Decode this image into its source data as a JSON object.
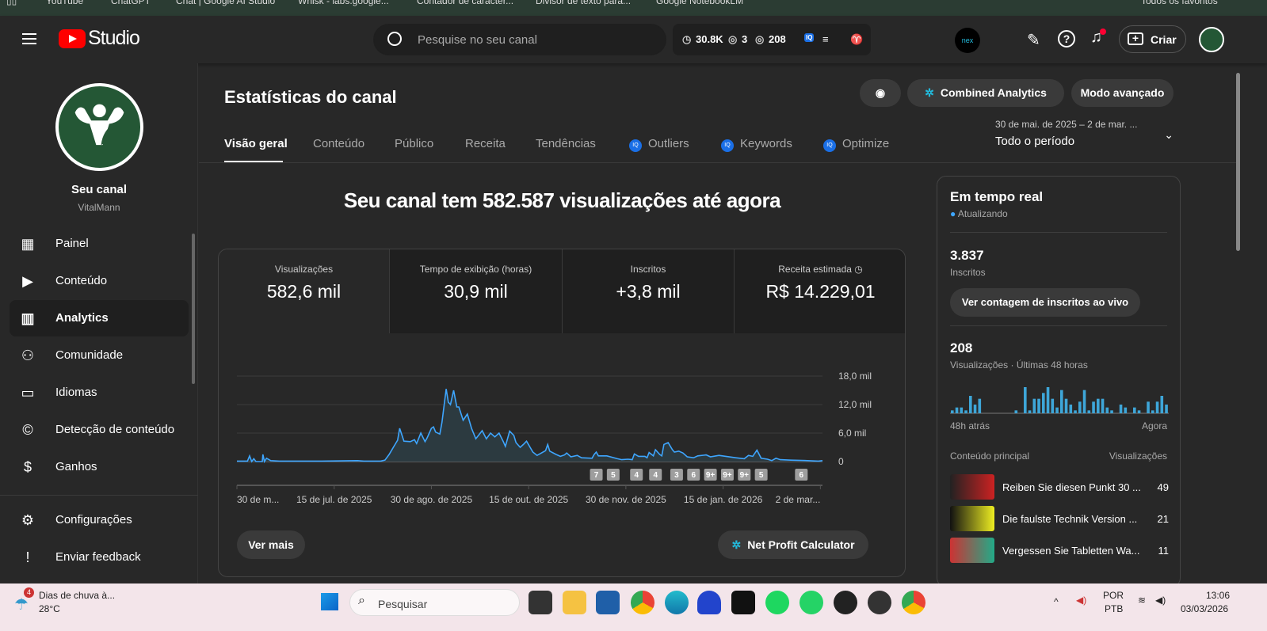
{
  "bookmarks": [
    "YouTube",
    "ChatGPT",
    "Chat | Google AI Studio",
    "Whisk - labs.google...",
    "Contador de caracter...",
    "Divisor de texto para...",
    "Google NotebookLM",
    "Todos os favoritos"
  ],
  "header": {
    "studio": "Studio",
    "search_placeholder": "Pesquise no seu canal",
    "watch_hours": "30.8K",
    "stat2": "3",
    "stat3": "208",
    "iq": "IQ",
    "criar": "Criar",
    "colors": {
      "accent": "#3ea6ff",
      "brand": "#ff0000"
    }
  },
  "sidebar": {
    "channel_title": "Seu canal",
    "channel_name": "VitalMann",
    "items": [
      {
        "label": "Painel",
        "icon": "dashboard-icon",
        "glyph": "▦"
      },
      {
        "label": "Conteúdo",
        "icon": "content-icon",
        "glyph": "▶"
      },
      {
        "label": "Analytics",
        "icon": "analytics-icon",
        "glyph": "▥"
      },
      {
        "label": "Comunidade",
        "icon": "community-icon",
        "glyph": "⚇"
      },
      {
        "label": "Idiomas",
        "icon": "subtitles-icon",
        "glyph": "▭"
      },
      {
        "label": "Detecção de conteúdo",
        "icon": "copyright-icon",
        "glyph": "©"
      },
      {
        "label": "Ganhos",
        "icon": "dollar-icon",
        "glyph": "$"
      }
    ],
    "bottom": [
      {
        "label": "Configurações",
        "icon": "gear-icon",
        "glyph": "⚙"
      },
      {
        "label": "Enviar feedback",
        "icon": "feedback-icon",
        "glyph": "!"
      }
    ]
  },
  "main": {
    "title": "Estatísticas do canal",
    "combined": "Combined Analytics",
    "advanced": "Modo avançado",
    "tabs": [
      "Visão geral",
      "Conteúdo",
      "Público",
      "Receita",
      "Tendências",
      "Outliers",
      "Keywords",
      "Optimize"
    ],
    "period_range": "30 de mai. de 2025 – 2 de mar. ...",
    "period": "Todo o período",
    "headline": "Seu canal tem 582.587 visualizações até agora",
    "metrics": [
      {
        "title": "Visualizações",
        "value": "582,6 mil"
      },
      {
        "title": "Tempo de exibição (horas)",
        "value": "30,9 mil"
      },
      {
        "title": "Inscritos",
        "value": "+3,8 mil"
      },
      {
        "title": "Receita estimada",
        "value": "R$ 14.229,01"
      }
    ],
    "see_more": "Ver mais",
    "net_profit": "Net Profit Calculator"
  },
  "chart_data": {
    "type": "area",
    "title": "Visualizações",
    "ylim": [
      0,
      18
    ],
    "yticks": [
      "18,0 mil",
      "12,0 mil",
      "6,0 mil",
      "0"
    ],
    "ytick_values": [
      18,
      12,
      6,
      0
    ],
    "xticks": [
      "30 de m...",
      "15 de jul. de 2025",
      "30 de ago. de 2025",
      "15 de out. de 2025",
      "30 de nov. de 2025",
      "15 de jan. de 2026",
      "2 de mar..."
    ],
    "xtick_days": [
      0,
      46,
      92,
      138,
      184,
      230,
      276
    ],
    "xlim": [
      0,
      277
    ],
    "points": [
      [
        0,
        0.1
      ],
      [
        5,
        0.1
      ],
      [
        6,
        1.2
      ],
      [
        7,
        0
      ],
      [
        8,
        0.6
      ],
      [
        9,
        0
      ],
      [
        12,
        0
      ],
      [
        12.3,
        1.5
      ],
      [
        13,
        0
      ],
      [
        14,
        0.7
      ],
      [
        16,
        0.2
      ],
      [
        20,
        0.1
      ],
      [
        40,
        0.1
      ],
      [
        57,
        0.2
      ],
      [
        60,
        0.1
      ],
      [
        68,
        0.1
      ],
      [
        70,
        0.3
      ],
      [
        72,
        1.5
      ],
      [
        74,
        3
      ],
      [
        76,
        4.5
      ],
      [
        77,
        7
      ],
      [
        79,
        4.3
      ],
      [
        82,
        4.2
      ],
      [
        84,
        4.6
      ],
      [
        85,
        3.8
      ],
      [
        87,
        6
      ],
      [
        89,
        4.2
      ],
      [
        90,
        5
      ],
      [
        92,
        7
      ],
      [
        93,
        7.3
      ],
      [
        94,
        6.2
      ],
      [
        96,
        5.8
      ],
      [
        97,
        8.3
      ],
      [
        99,
        15.3
      ],
      [
        100,
        12.5
      ],
      [
        101,
        12
      ],
      [
        102.5,
        15
      ],
      [
        104,
        11.5
      ],
      [
        105,
        11.5
      ],
      [
        107,
        8.7
      ],
      [
        109,
        10
      ],
      [
        111,
        7
      ],
      [
        113,
        4.8
      ],
      [
        116,
        6.5
      ],
      [
        118,
        4.8
      ],
      [
        120,
        6
      ],
      [
        122,
        5.2
      ],
      [
        124,
        6
      ],
      [
        126,
        4.2
      ],
      [
        127,
        3.2
      ],
      [
        129,
        6.4
      ],
      [
        131,
        5.5
      ],
      [
        132,
        4
      ],
      [
        134,
        3
      ],
      [
        135.5,
        3.6
      ],
      [
        137,
        4.3
      ],
      [
        140,
        2
      ],
      [
        142,
        1.3
      ],
      [
        144,
        1.8
      ],
      [
        146,
        2.3
      ],
      [
        147,
        3.6
      ],
      [
        148,
        2.2
      ],
      [
        151,
        1.5
      ],
      [
        153,
        1.1
      ],
      [
        155,
        1.4
      ],
      [
        156,
        1.8
      ],
      [
        158,
        1
      ],
      [
        161,
        1.3
      ],
      [
        163,
        0.8
      ],
      [
        168,
        0.7
      ],
      [
        169,
        1.5
      ],
      [
        170,
        2
      ],
      [
        171,
        1.2
      ],
      [
        175,
        1.2
      ],
      [
        180,
        0.6
      ],
      [
        182,
        0.4
      ],
      [
        185,
        0.5
      ],
      [
        187,
        0.4
      ],
      [
        188,
        1.6
      ],
      [
        190,
        1.1
      ],
      [
        193,
        1.1
      ],
      [
        194,
        0.8
      ],
      [
        195,
        1.9
      ],
      [
        197,
        1.2
      ],
      [
        198,
        2.5
      ],
      [
        200,
        1.5
      ],
      [
        201,
        1.2
      ],
      [
        202,
        3.6
      ],
      [
        204,
        4
      ],
      [
        206,
        2.5
      ],
      [
        207,
        2
      ],
      [
        209,
        2.2
      ],
      [
        211,
        1.8
      ],
      [
        213,
        1
      ],
      [
        216,
        0.8
      ],
      [
        218,
        1.2
      ],
      [
        222,
        1.4
      ],
      [
        224,
        1
      ],
      [
        228,
        1.3
      ],
      [
        236,
        0.8
      ],
      [
        240,
        0.6
      ],
      [
        242,
        1.3
      ],
      [
        244,
        1.1
      ],
      [
        246,
        2.4
      ],
      [
        248,
        0.7
      ],
      [
        251,
        0.5
      ],
      [
        253,
        0.2
      ],
      [
        255,
        0.7
      ],
      [
        257,
        0.4
      ],
      [
        262,
        0.3
      ],
      [
        270,
        0.2
      ],
      [
        275,
        0.1
      ],
      [
        277,
        0.2
      ]
    ],
    "annotations": [
      {
        "day": 170,
        "label": "7"
      },
      {
        "day": 178,
        "label": "5"
      },
      {
        "day": 189,
        "label": "4"
      },
      {
        "day": 198,
        "label": "4"
      },
      {
        "day": 208,
        "label": "3"
      },
      {
        "day": 216,
        "label": "6"
      },
      {
        "day": 224,
        "label": "9+"
      },
      {
        "day": 232,
        "label": "9+"
      },
      {
        "day": 240,
        "label": "9+"
      },
      {
        "day": 248,
        "label": "5"
      },
      {
        "day": 267,
        "label": "6"
      }
    ]
  },
  "realtime": {
    "title": "Em tempo real",
    "status": "Atualizando",
    "subs": "3.837",
    "subs_label": "Inscritos",
    "live_btn": "Ver contagem de inscritos ao vivo",
    "views": "208",
    "views_label": "Visualizações · Últimas 48 horas",
    "ago": "48h atrás",
    "now": "Agora",
    "top_label": "Conteúdo principal",
    "views_col": "Visualizações",
    "bars": [
      1,
      2,
      2,
      1,
      6,
      3,
      5,
      0,
      0,
      0,
      0,
      0,
      0,
      0,
      1,
      0,
      9,
      1,
      5,
      5,
      7,
      9,
      5,
      2,
      8,
      5,
      3,
      1,
      4,
      8,
      1,
      4,
      5,
      5,
      2,
      1,
      0,
      3,
      2,
      0,
      2,
      1,
      0,
      4,
      1,
      4,
      6,
      3
    ],
    "top": [
      {
        "title": "Reiben Sie diesen Punkt 30 ...",
        "views": "49"
      },
      {
        "title": "Die faulste Technik Version ...",
        "views": "21"
      },
      {
        "title": "Vergessen Sie Tabletten Wa...",
        "views": "11"
      }
    ]
  },
  "taskbar": {
    "weather": "Dias de chuva à...",
    "temp": "28°C",
    "weather_badge": "4",
    "search": "Pesquisar",
    "lang1": "POR",
    "lang2": "PTB",
    "time": "13:06",
    "date": "03/03/2026"
  }
}
